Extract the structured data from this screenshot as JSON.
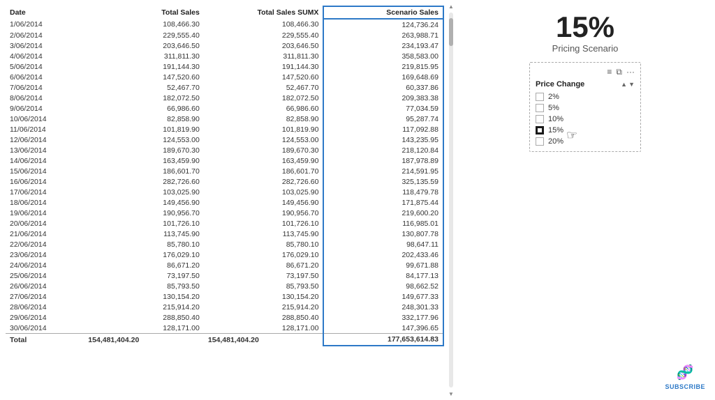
{
  "table": {
    "headers": {
      "date": "Date",
      "total_sales": "Total Sales",
      "total_sales_sumx": "Total Sales SUMX",
      "scenario_sales": "Scenario Sales"
    },
    "rows": [
      {
        "date": "1/06/2014",
        "total_sales": "108,466.30",
        "total_sales_sumx": "108,466.30",
        "scenario_sales": "124,736.24"
      },
      {
        "date": "2/06/2014",
        "total_sales": "229,555.40",
        "total_sales_sumx": "229,555.40",
        "scenario_sales": "263,988.71"
      },
      {
        "date": "3/06/2014",
        "total_sales": "203,646.50",
        "total_sales_sumx": "203,646.50",
        "scenario_sales": "234,193.47"
      },
      {
        "date": "4/06/2014",
        "total_sales": "311,811.30",
        "total_sales_sumx": "311,811.30",
        "scenario_sales": "358,583.00"
      },
      {
        "date": "5/06/2014",
        "total_sales": "191,144.30",
        "total_sales_sumx": "191,144.30",
        "scenario_sales": "219,815.95"
      },
      {
        "date": "6/06/2014",
        "total_sales": "147,520.60",
        "total_sales_sumx": "147,520.60",
        "scenario_sales": "169,648.69"
      },
      {
        "date": "7/06/2014",
        "total_sales": "52,467.70",
        "total_sales_sumx": "52,467.70",
        "scenario_sales": "60,337.86"
      },
      {
        "date": "8/06/2014",
        "total_sales": "182,072.50",
        "total_sales_sumx": "182,072.50",
        "scenario_sales": "209,383.38"
      },
      {
        "date": "9/06/2014",
        "total_sales": "66,986.60",
        "total_sales_sumx": "66,986.60",
        "scenario_sales": "77,034.59"
      },
      {
        "date": "10/06/2014",
        "total_sales": "82,858.90",
        "total_sales_sumx": "82,858.90",
        "scenario_sales": "95,287.74"
      },
      {
        "date": "11/06/2014",
        "total_sales": "101,819.90",
        "total_sales_sumx": "101,819.90",
        "scenario_sales": "117,092.88"
      },
      {
        "date": "12/06/2014",
        "total_sales": "124,553.00",
        "total_sales_sumx": "124,553.00",
        "scenario_sales": "143,235.95"
      },
      {
        "date": "13/06/2014",
        "total_sales": "189,670.30",
        "total_sales_sumx": "189,670.30",
        "scenario_sales": "218,120.84"
      },
      {
        "date": "14/06/2014",
        "total_sales": "163,459.90",
        "total_sales_sumx": "163,459.90",
        "scenario_sales": "187,978.89"
      },
      {
        "date": "15/06/2014",
        "total_sales": "186,601.70",
        "total_sales_sumx": "186,601.70",
        "scenario_sales": "214,591.95"
      },
      {
        "date": "16/06/2014",
        "total_sales": "282,726.60",
        "total_sales_sumx": "282,726.60",
        "scenario_sales": "325,135.59"
      },
      {
        "date": "17/06/2014",
        "total_sales": "103,025.90",
        "total_sales_sumx": "103,025.90",
        "scenario_sales": "118,479.78"
      },
      {
        "date": "18/06/2014",
        "total_sales": "149,456.90",
        "total_sales_sumx": "149,456.90",
        "scenario_sales": "171,875.44"
      },
      {
        "date": "19/06/2014",
        "total_sales": "190,956.70",
        "total_sales_sumx": "190,956.70",
        "scenario_sales": "219,600.20"
      },
      {
        "date": "20/06/2014",
        "total_sales": "101,726.10",
        "total_sales_sumx": "101,726.10",
        "scenario_sales": "116,985.01"
      },
      {
        "date": "21/06/2014",
        "total_sales": "113,745.90",
        "total_sales_sumx": "113,745.90",
        "scenario_sales": "130,807.78"
      },
      {
        "date": "22/06/2014",
        "total_sales": "85,780.10",
        "total_sales_sumx": "85,780.10",
        "scenario_sales": "98,647.11"
      },
      {
        "date": "23/06/2014",
        "total_sales": "176,029.10",
        "total_sales_sumx": "176,029.10",
        "scenario_sales": "202,433.46"
      },
      {
        "date": "24/06/2014",
        "total_sales": "86,671.20",
        "total_sales_sumx": "86,671.20",
        "scenario_sales": "99,671.88"
      },
      {
        "date": "25/06/2014",
        "total_sales": "73,197.50",
        "total_sales_sumx": "73,197.50",
        "scenario_sales": "84,177.13"
      },
      {
        "date": "26/06/2014",
        "total_sales": "85,793.50",
        "total_sales_sumx": "85,793.50",
        "scenario_sales": "98,662.52"
      },
      {
        "date": "27/06/2014",
        "total_sales": "130,154.20",
        "total_sales_sumx": "130,154.20",
        "scenario_sales": "149,677.33"
      },
      {
        "date": "28/06/2014",
        "total_sales": "215,914.20",
        "total_sales_sumx": "215,914.20",
        "scenario_sales": "248,301.33"
      },
      {
        "date": "29/06/2014",
        "total_sales": "288,850.40",
        "total_sales_sumx": "288,850.40",
        "scenario_sales": "332,177.96"
      },
      {
        "date": "30/06/2014",
        "total_sales": "128,171.00",
        "total_sales_sumx": "128,171.00",
        "scenario_sales": "147,396.65"
      }
    ],
    "footer": {
      "label": "Total",
      "total_sales": "154,481,404.20",
      "total_sales_sumx": "154,481,404.20",
      "scenario_sales": "177,653,614.83"
    }
  },
  "pricing_scenario": {
    "percentage": "15%",
    "label": "Pricing Scenario",
    "card": {
      "header": "Price Change",
      "options": [
        {
          "label": "2%",
          "checked": false
        },
        {
          "label": "5%",
          "checked": false
        },
        {
          "label": "10%",
          "checked": false
        },
        {
          "label": "15%",
          "checked": true
        },
        {
          "label": "20%",
          "checked": false
        }
      ]
    }
  },
  "subscribe": {
    "label": "SUBSCRIBE"
  }
}
